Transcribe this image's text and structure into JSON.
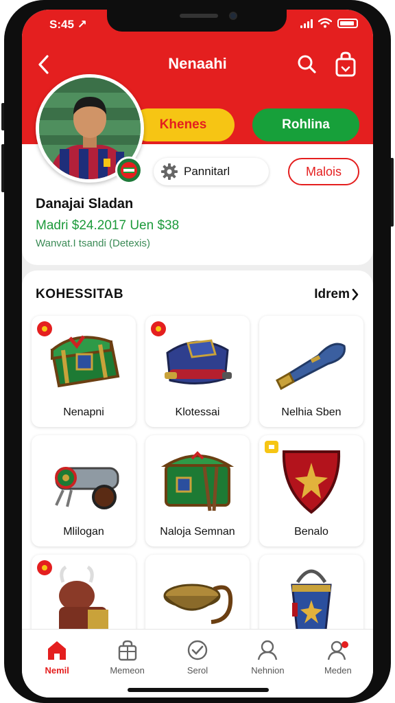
{
  "status_bar": {
    "time": "S:45 ↗"
  },
  "top_bar": {
    "title": "Nenaahi"
  },
  "profile": {
    "yellow_pill": "Khenes",
    "green_pill": "Rohlina",
    "settings_chip": "Pannitarl",
    "outline_button": "Malois",
    "name": "Danajai Sladan",
    "balance": "Madri $24.2017 Uen $38",
    "subtitle": "Wanvat.I tsandi (Detexis)"
  },
  "collection": {
    "title": "KOHESSITAB",
    "more_label": "Idrem",
    "items": [
      {
        "label": "Nenapni",
        "icon": "treasure-chest-icon",
        "tag": "red"
      },
      {
        "label": "Klotessai",
        "icon": "bedroll-icon",
        "tag": "red"
      },
      {
        "label": "Nelhia Sben",
        "icon": "horn-icon",
        "tag": "none"
      },
      {
        "label": "Mlilogan",
        "icon": "cannon-icon",
        "tag": "none"
      },
      {
        "label": "Naloja Semnan",
        "icon": "green-chest-icon",
        "tag": "none"
      },
      {
        "label": "Benalo",
        "icon": "shield-icon",
        "tag": "yellow"
      },
      {
        "label": "",
        "icon": "bull-statue-icon",
        "tag": "red"
      },
      {
        "label": "",
        "icon": "rope-bowl-icon",
        "tag": "none"
      },
      {
        "label": "",
        "icon": "bucket-icon",
        "tag": "none"
      }
    ]
  },
  "bottom_nav": [
    {
      "label": "Nemil",
      "icon": "home-icon",
      "active": true
    },
    {
      "label": "Memeon",
      "icon": "bag-icon",
      "active": false
    },
    {
      "label": "Serol",
      "icon": "check-circle-icon",
      "active": false
    },
    {
      "label": "Nehnion",
      "icon": "user-icon",
      "active": false
    },
    {
      "label": "Meden",
      "icon": "user-notification-icon",
      "active": false
    }
  ],
  "colors": {
    "brand_red": "#e41f1f",
    "green": "#17a03a",
    "yellow": "#f6c514"
  }
}
